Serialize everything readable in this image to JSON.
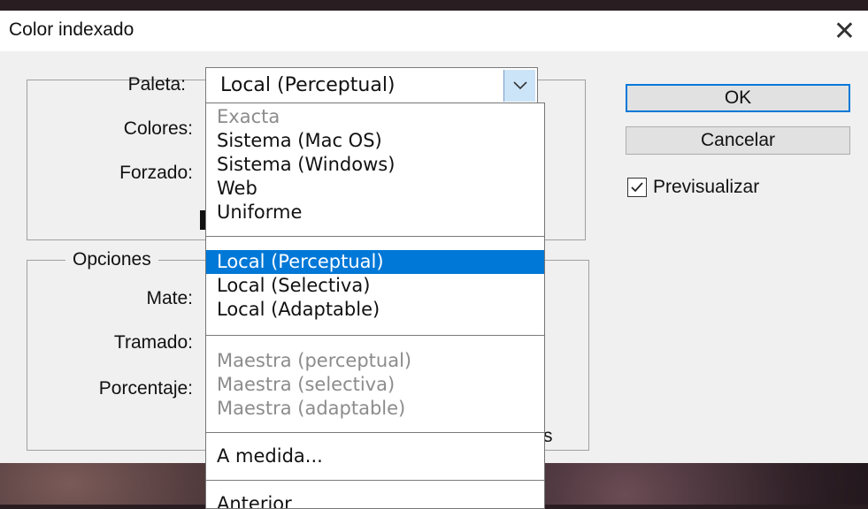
{
  "dialog": {
    "title": "Color indexado"
  },
  "palette_group": {
    "paleta_label": "Paleta:",
    "colores_label": "Colores:",
    "forzado_label": "Forzado:",
    "selected_value": "Local (Perceptual)"
  },
  "options_group": {
    "legend": "Opciones",
    "mate_label": "Mate:",
    "tramado_label": "Tramado:",
    "porcentaje_label": "Porcentaje:",
    "partial_text": "s"
  },
  "buttons": {
    "ok": "OK",
    "cancel": "Cancelar"
  },
  "preview": {
    "label": "Previsualizar",
    "checked": true
  },
  "dropdown": {
    "group1": [
      "Exacta",
      "Sistema (Mac OS)",
      "Sistema (Windows)",
      "Web",
      "Uniforme"
    ],
    "group2": [
      "Local (Perceptual)",
      "Local (Selectiva)",
      "Local (Adaptable)"
    ],
    "group3": [
      "Maestra (perceptual)",
      "Maestra (selectiva)",
      "Maestra (adaptable)"
    ],
    "group4": [
      "A medida..."
    ],
    "group5": [
      "Anterior"
    ]
  },
  "colors": {
    "accent": "#0078d7",
    "disabled_text": "#8c8c8c"
  }
}
